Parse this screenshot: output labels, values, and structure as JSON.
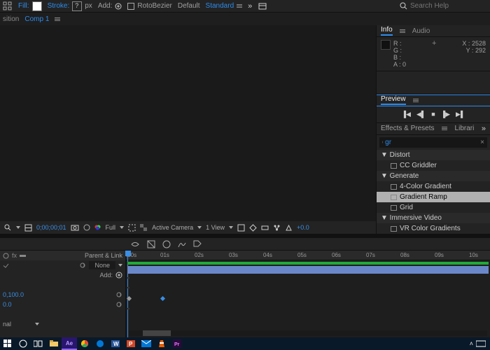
{
  "toolbar": {
    "fill_label": "Fill:",
    "stroke_label": "Stroke:",
    "stroke_width": "px",
    "add_label": "Add:",
    "rotobezier": "RotoBezier",
    "default": "Default",
    "standard": "Standard",
    "search_placeholder": "Search Help"
  },
  "tabs": {
    "composition": "sition",
    "comp_name": "Comp 1"
  },
  "viewer": {
    "timecode": "0;00;00;01",
    "resolution": "Full",
    "camera": "Active Camera",
    "view_count": "1 View",
    "exposure": "+0.0"
  },
  "info": {
    "tab_info": "Info",
    "tab_audio": "Audio",
    "R": "R :",
    "G": "G :",
    "B": "B :",
    "A": "A :",
    "a_val": "0",
    "X": "X :",
    "Y": "Y :",
    "x_val": "2528",
    "y_val": "292"
  },
  "preview": {
    "title": "Preview"
  },
  "effects": {
    "title": "Effects & Presets",
    "libraries": "Librari",
    "search_value": "gr",
    "categories": [
      {
        "name": "Distort",
        "items": [
          "CC Griddler"
        ],
        "selected": -1
      },
      {
        "name": "Generate",
        "items": [
          "4-Color Gradient",
          "Gradient Ramp",
          "Grid"
        ],
        "selected": 1
      },
      {
        "name": "Immersive Video",
        "items": [
          "VR Color Gradients"
        ],
        "selected": -1
      }
    ]
  },
  "timeline": {
    "parent_link": "Parent & Link",
    "none_opt": "None",
    "add_label": "Add:",
    "anchor": "0,100.0",
    "zero": "0.0",
    "normal": "nal",
    "ruler": [
      ":00s",
      "01s",
      "02s",
      "03s",
      "04s",
      "05s",
      "06s",
      "07s",
      "08s",
      "09s",
      "10s"
    ]
  }
}
